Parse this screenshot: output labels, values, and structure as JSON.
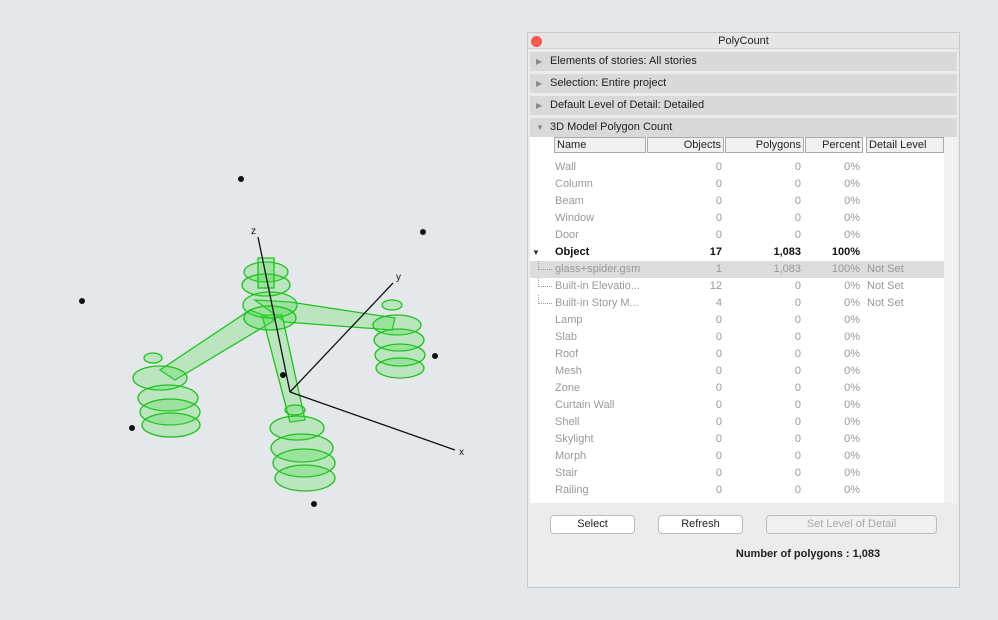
{
  "viewport": {
    "axes": {
      "x": "x",
      "y": "y",
      "z": "z"
    },
    "model_color": "#22cc22"
  },
  "panel": {
    "title": "PolyCount",
    "sections": [
      {
        "label": "Elements of stories: All stories",
        "expanded": false
      },
      {
        "label": "Selection: Entire project",
        "expanded": false
      },
      {
        "label": "Default Level of Detail: Detailed",
        "expanded": false
      },
      {
        "label": "3D Model Polygon Count",
        "expanded": true
      }
    ],
    "columns": [
      "Name",
      "Objects",
      "Polygons",
      "Percent",
      "Detail Level"
    ],
    "rows": [
      {
        "name": "Wall",
        "objects": "0",
        "polygons": "0",
        "percent": "0%",
        "detail": ""
      },
      {
        "name": "Column",
        "objects": "0",
        "polygons": "0",
        "percent": "0%",
        "detail": ""
      },
      {
        "name": "Beam",
        "objects": "0",
        "polygons": "0",
        "percent": "0%",
        "detail": ""
      },
      {
        "name": "Window",
        "objects": "0",
        "polygons": "0",
        "percent": "0%",
        "detail": ""
      },
      {
        "name": "Door",
        "objects": "0",
        "polygons": "0",
        "percent": "0%",
        "detail": ""
      },
      {
        "name": "Object",
        "objects": "17",
        "polygons": "1,083",
        "percent": "100%",
        "detail": "",
        "bold": true,
        "expanded": true
      },
      {
        "name": "glass+spider.gsm",
        "objects": "1",
        "polygons": "1,083",
        "percent": "100%",
        "detail": "Not Set",
        "child": true,
        "selected": true
      },
      {
        "name": "Built-in Elevatio...",
        "objects": "12",
        "polygons": "0",
        "percent": "0%",
        "detail": "Not Set",
        "child": true
      },
      {
        "name": "Built-in Story M...",
        "objects": "4",
        "polygons": "0",
        "percent": "0%",
        "detail": "Not Set",
        "child": true
      },
      {
        "name": "Lamp",
        "objects": "0",
        "polygons": "0",
        "percent": "0%",
        "detail": ""
      },
      {
        "name": "Slab",
        "objects": "0",
        "polygons": "0",
        "percent": "0%",
        "detail": ""
      },
      {
        "name": "Roof",
        "objects": "0",
        "polygons": "0",
        "percent": "0%",
        "detail": ""
      },
      {
        "name": "Mesh",
        "objects": "0",
        "polygons": "0",
        "percent": "0%",
        "detail": ""
      },
      {
        "name": "Zone",
        "objects": "0",
        "polygons": "0",
        "percent": "0%",
        "detail": ""
      },
      {
        "name": "Curtain Wall",
        "objects": "0",
        "polygons": "0",
        "percent": "0%",
        "detail": ""
      },
      {
        "name": "Shell",
        "objects": "0",
        "polygons": "0",
        "percent": "0%",
        "detail": ""
      },
      {
        "name": "Skylight",
        "objects": "0",
        "polygons": "0",
        "percent": "0%",
        "detail": ""
      },
      {
        "name": "Morph",
        "objects": "0",
        "polygons": "0",
        "percent": "0%",
        "detail": ""
      },
      {
        "name": "Stair",
        "objects": "0",
        "polygons": "0",
        "percent": "0%",
        "detail": ""
      },
      {
        "name": "Railing",
        "objects": "0",
        "polygons": "0",
        "percent": "0%",
        "detail": ""
      }
    ],
    "buttons": {
      "select": "Select",
      "refresh": "Refresh",
      "set_lod": "Set Level of Detail"
    },
    "footer": "Number of polygons : 1,083"
  }
}
